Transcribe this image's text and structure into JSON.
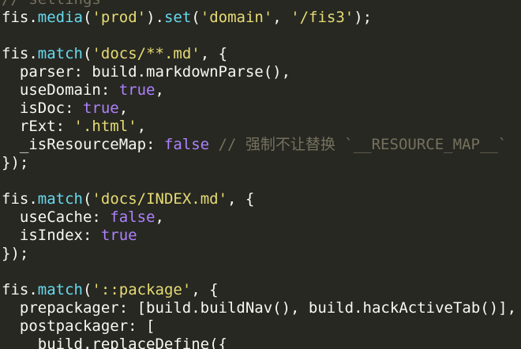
{
  "editor": {
    "lines": [
      [
        {
          "t": "// settings",
          "c": "cm"
        }
      ],
      [
        {
          "t": "fis",
          "c": "id"
        },
        {
          "t": ".",
          "c": "pn"
        },
        {
          "t": "media",
          "c": "prop"
        },
        {
          "t": "(",
          "c": "pn"
        },
        {
          "t": "'prod'",
          "c": "str"
        },
        {
          "t": ").",
          "c": "pn"
        },
        {
          "t": "set",
          "c": "prop"
        },
        {
          "t": "(",
          "c": "pn"
        },
        {
          "t": "'domain'",
          "c": "str"
        },
        {
          "t": ", ",
          "c": "pn"
        },
        {
          "t": "'/fis3'",
          "c": "str"
        },
        {
          "t": ");",
          "c": "pn"
        }
      ],
      [],
      [
        {
          "t": "fis",
          "c": "id"
        },
        {
          "t": ".",
          "c": "pn"
        },
        {
          "t": "match",
          "c": "prop"
        },
        {
          "t": "(",
          "c": "pn"
        },
        {
          "t": "'docs/**.md'",
          "c": "str"
        },
        {
          "t": ", {",
          "c": "pn"
        }
      ],
      [
        {
          "t": "  parser: build.markdownParse(),",
          "c": "id"
        }
      ],
      [
        {
          "t": "  useDomain: ",
          "c": "id"
        },
        {
          "t": "true",
          "c": "kw"
        },
        {
          "t": ",",
          "c": "pn"
        }
      ],
      [
        {
          "t": "  isDoc: ",
          "c": "id"
        },
        {
          "t": "true",
          "c": "kw"
        },
        {
          "t": ",",
          "c": "pn"
        }
      ],
      [
        {
          "t": "  rExt: ",
          "c": "id"
        },
        {
          "t": "'.html'",
          "c": "str"
        },
        {
          "t": ",",
          "c": "pn"
        }
      ],
      [
        {
          "t": "  _isResourceMap: ",
          "c": "id"
        },
        {
          "t": "false",
          "c": "kw"
        },
        {
          "t": " // 强制不让替换 `__RESOURCE_MAP__`",
          "c": "cm"
        }
      ],
      [
        {
          "t": "});",
          "c": "pn"
        }
      ],
      [],
      [
        {
          "t": "fis",
          "c": "id"
        },
        {
          "t": ".",
          "c": "pn"
        },
        {
          "t": "match",
          "c": "prop"
        },
        {
          "t": "(",
          "c": "pn"
        },
        {
          "t": "'docs/INDEX.md'",
          "c": "str"
        },
        {
          "t": ", {",
          "c": "pn"
        }
      ],
      [
        {
          "t": "  useCache: ",
          "c": "id"
        },
        {
          "t": "false",
          "c": "kw"
        },
        {
          "t": ",",
          "c": "pn"
        }
      ],
      [
        {
          "t": "  isIndex: ",
          "c": "id"
        },
        {
          "t": "true",
          "c": "kw"
        }
      ],
      [
        {
          "t": "});",
          "c": "pn"
        }
      ],
      [],
      [
        {
          "t": "fis",
          "c": "id"
        },
        {
          "t": ".",
          "c": "pn"
        },
        {
          "t": "match",
          "c": "prop"
        },
        {
          "t": "(",
          "c": "pn"
        },
        {
          "t": "'::package'",
          "c": "str"
        },
        {
          "t": ", {",
          "c": "pn"
        }
      ],
      [
        {
          "t": "  prepackager: [build.buildNav(), build.hackActiveTab()],",
          "c": "id"
        }
      ],
      [
        {
          "t": "  postpackager: [",
          "c": "id"
        }
      ],
      [
        {
          "t": "    build.replaceDefine({",
          "c": "id"
        }
      ]
    ]
  }
}
